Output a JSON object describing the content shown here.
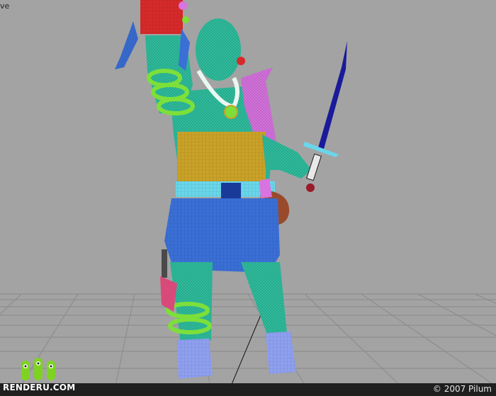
{
  "viewport": {
    "view_label": "ve",
    "background_color": "#a3a3a3",
    "grid_color": "#8a8a8a"
  },
  "model": {
    "colors": {
      "skin": "#2fbf9f",
      "skin_wire": "#1a8f6e",
      "armor_band": "#c9a227",
      "armband": "#7ddf3a",
      "kilt": "#3a6fd6",
      "belt": "#6ad6ea",
      "sword_blade": "#1a1a9a",
      "pouch": "#9a4a2a",
      "shoulder_pad": "#d873e0",
      "headband": "#d62a2a"
    }
  },
  "watermark": {
    "logo_text": "RENDERU.COM",
    "logo_color": "#7ed321"
  },
  "footer": {
    "copyright": "© 2007 Pilum"
  }
}
